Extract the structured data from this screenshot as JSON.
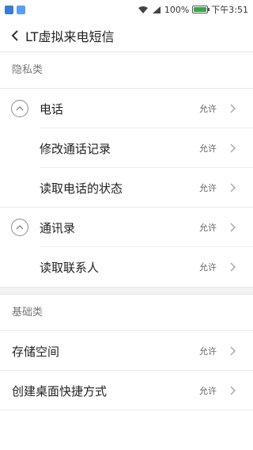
{
  "status_bar": {
    "battery_percent": "100%",
    "battery_level": 1.0,
    "time": "下午3:51",
    "icons": [
      "notification-app-icon-1",
      "notification-app-icon-2",
      "wifi-icon",
      "signal-icon",
      "battery-icon"
    ]
  },
  "header": {
    "title": "LT虚拟来电短信"
  },
  "sections": {
    "privacy": {
      "title": "隐私类",
      "phone_group": {
        "label": "电话",
        "value": "允许"
      },
      "modify_call_log": {
        "label": "修改通话记录",
        "value": "允许"
      },
      "read_phone_state": {
        "label": "读取电话的状态",
        "value": "允许"
      },
      "contacts_group": {
        "label": "通讯录",
        "value": "允许"
      },
      "read_contacts": {
        "label": "读取联系人",
        "value": "允许"
      }
    },
    "basic": {
      "title": "基础类",
      "storage": {
        "label": "存储空间",
        "value": "允许"
      },
      "shortcut": {
        "label": "创建桌面快捷方式",
        "value": "允许"
      }
    }
  },
  "colors": {
    "accent_battery": "#3ca34a",
    "notif_icon_1": "#3a7bd5",
    "notif_icon_2": "#2f80ed"
  }
}
